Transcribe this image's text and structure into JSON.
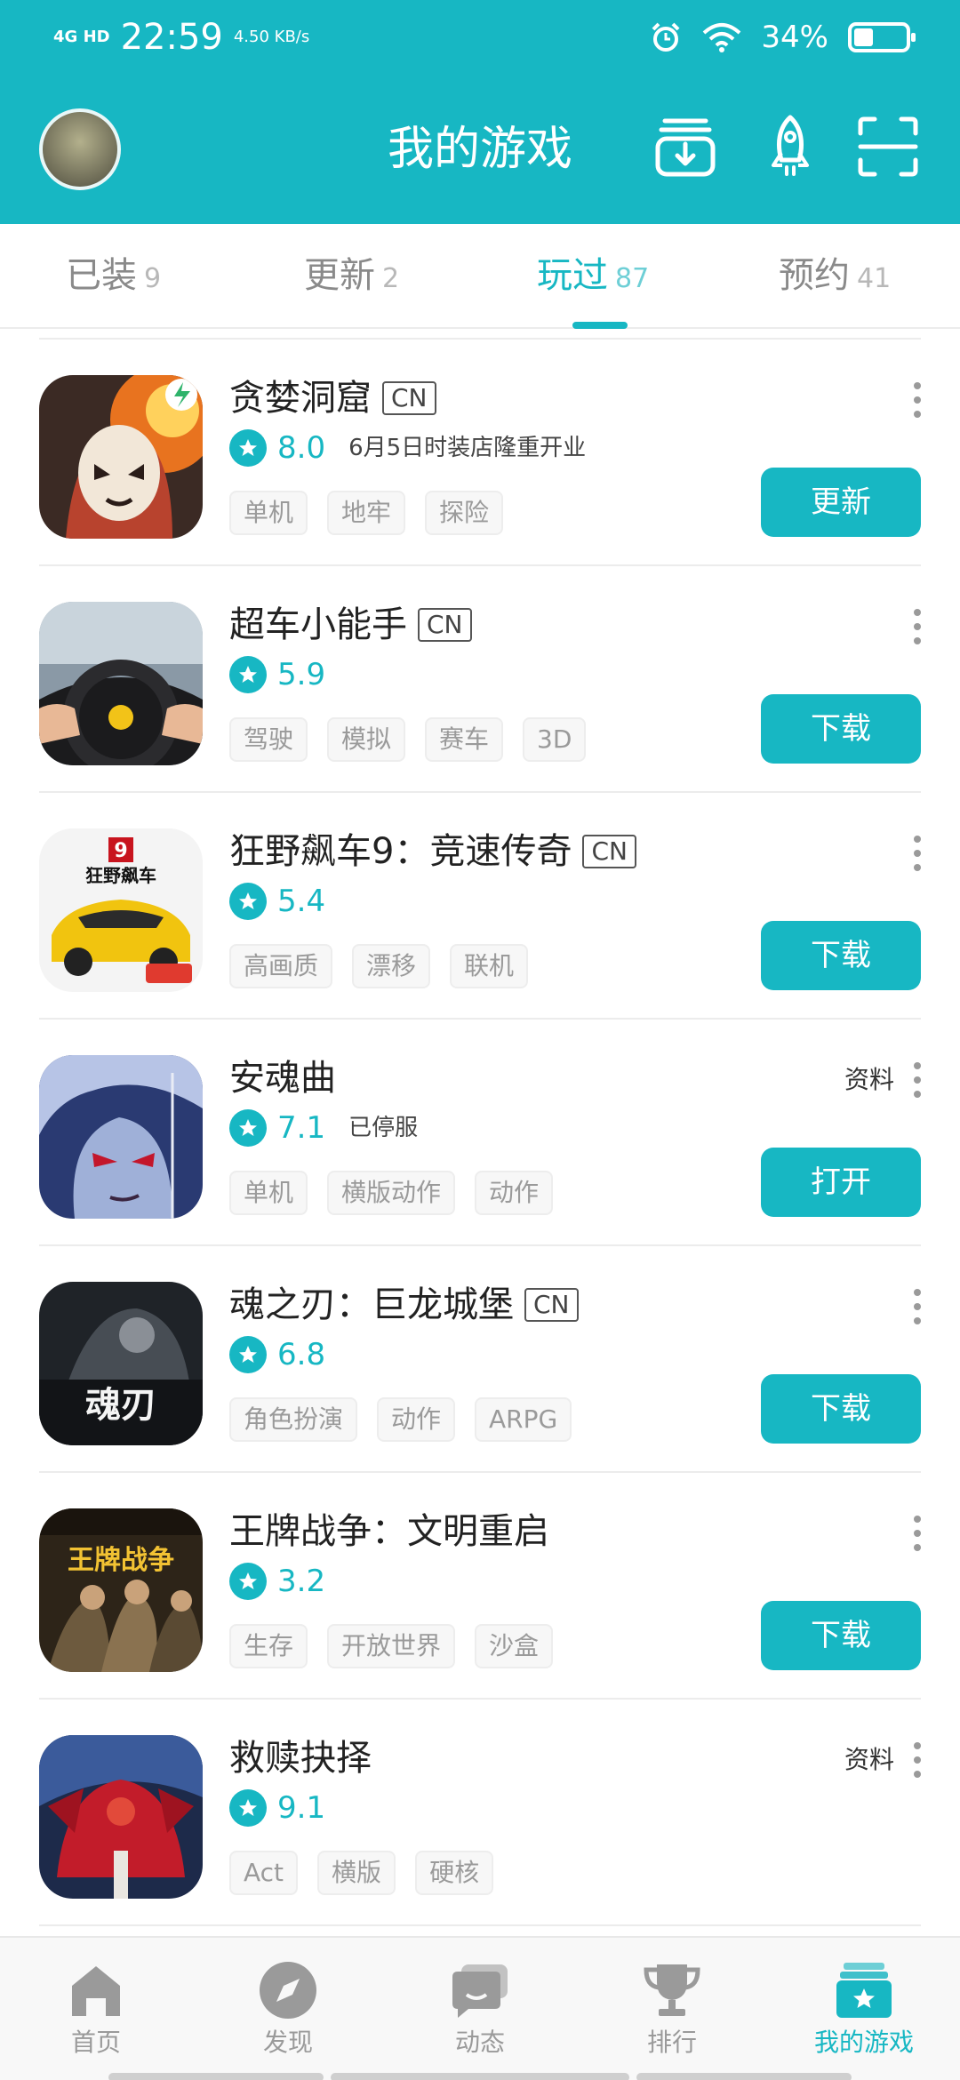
{
  "status_bar": {
    "signal": "4G HD",
    "time": "22:59",
    "speed": "4.50 KB/s",
    "battery": "34%"
  },
  "header": {
    "title": "我的游戏",
    "icons": [
      "download-manager-icon",
      "rocket-icon",
      "scan-icon"
    ]
  },
  "tabs": [
    {
      "label": "已装",
      "count": "9"
    },
    {
      "label": "更新",
      "count": "2"
    },
    {
      "label": "玩过",
      "count": "87",
      "active": true
    },
    {
      "label": "预约",
      "count": "41"
    }
  ],
  "games": [
    {
      "name": "贪婪洞窟",
      "badge": "CN",
      "rating": "8.0",
      "note": "6月5日时装店隆重开业",
      "tags": [
        "单机",
        "地牢",
        "探险"
      ],
      "action": "更新",
      "info": ""
    },
    {
      "name": "超车小能手",
      "badge": "CN",
      "rating": "5.9",
      "note": "",
      "tags": [
        "驾驶",
        "模拟",
        "赛车",
        "3D"
      ],
      "action": "下载",
      "info": ""
    },
    {
      "name": "狂野飙车9：竞速传奇",
      "badge": "CN",
      "rating": "5.4",
      "note": "",
      "tags": [
        "高画质",
        "漂移",
        "联机"
      ],
      "action": "下载",
      "info": ""
    },
    {
      "name": "安魂曲",
      "badge": "",
      "rating": "7.1",
      "note": "已停服",
      "tags": [
        "单机",
        "横版动作",
        "动作"
      ],
      "action": "打开",
      "info": "资料"
    },
    {
      "name": "魂之刃：巨龙城堡",
      "badge": "CN",
      "rating": "6.8",
      "note": "",
      "tags": [
        "角色扮演",
        "动作",
        "ARPG"
      ],
      "action": "下载",
      "info": ""
    },
    {
      "name": "王牌战争：文明重启",
      "badge": "",
      "rating": "3.2",
      "note": "",
      "tags": [
        "生存",
        "开放世界",
        "沙盒"
      ],
      "action": "下载",
      "info": ""
    },
    {
      "name": "救赎抉择",
      "badge": "",
      "rating": "9.1",
      "note": "",
      "tags": [
        "Act",
        "横版",
        "硬核"
      ],
      "action": "",
      "info": "资料"
    }
  ],
  "icon_art_text": {
    "game3_icon": "狂野飙车",
    "game5_icon": "魂刃",
    "game6_icon": "王牌战争"
  },
  "bottom_nav": [
    {
      "label": "首页",
      "icon": "home-icon"
    },
    {
      "label": "发现",
      "icon": "compass-icon"
    },
    {
      "label": "动态",
      "icon": "chat-icon"
    },
    {
      "label": "排行",
      "icon": "trophy-icon"
    },
    {
      "label": "我的游戏",
      "icon": "my-games-icon",
      "active": true
    }
  ],
  "colors": {
    "accent": "#17b7c3",
    "tag_text": "#9a9a9a",
    "inactive_nav": "#9a9a9a"
  }
}
